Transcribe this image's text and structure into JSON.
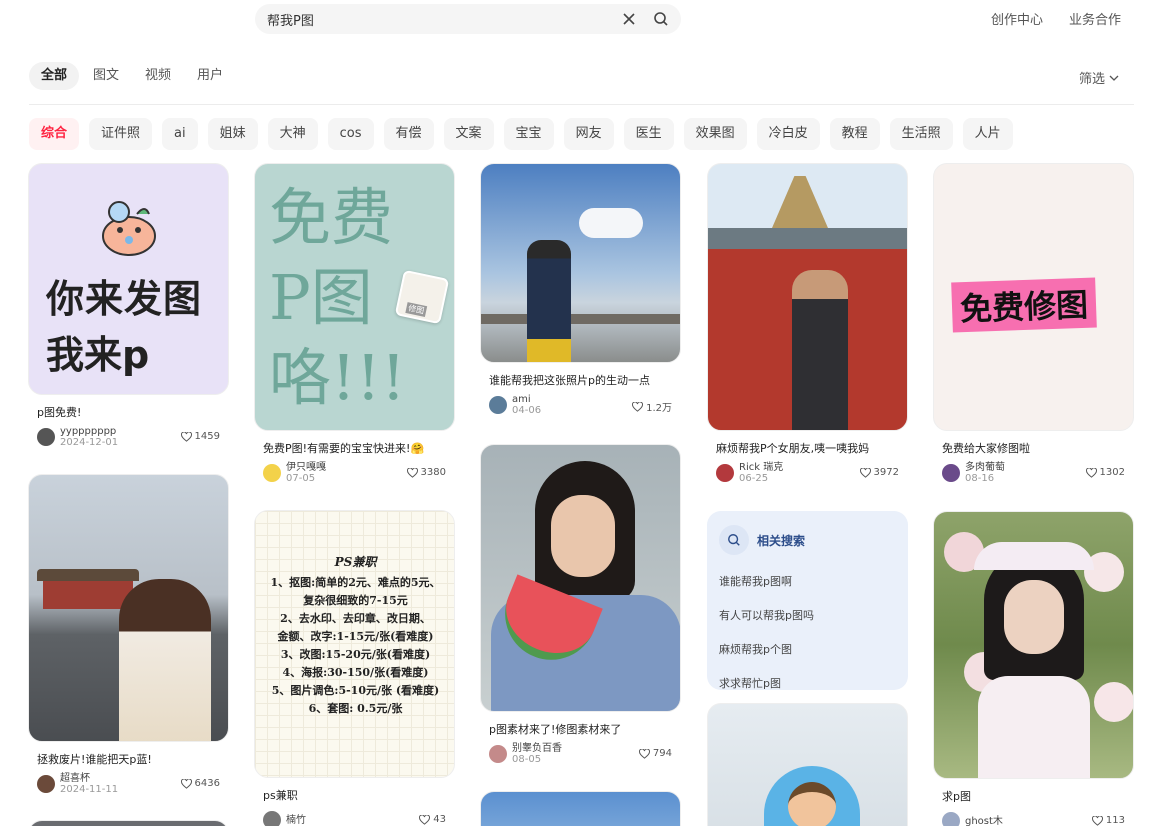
{
  "search": {
    "query": "帮我P图"
  },
  "top_links": [
    "创作中心",
    "业务合作"
  ],
  "tabs": [
    "全部",
    "图文",
    "视频",
    "用户"
  ],
  "filter_label": "筛选",
  "chips": [
    "综合",
    "证件照",
    "ai",
    "姐妹",
    "大神",
    "cos",
    "有偿",
    "文案",
    "宝宝",
    "网友",
    "医生",
    "效果图",
    "冷白皮",
    "教程",
    "生活照",
    "人片"
  ],
  "covers": {
    "c1_line1": "你来发图",
    "c1_line2": "我来p",
    "c2_text": "免费P图咯!!!",
    "c2_label": "修图",
    "c5_text": "免费修图",
    "c8_title": "PS兼职",
    "c8_lines": [
      "1、抠图:简单的2元、难点的5元、",
      "复杂很细致的7-15元",
      "2、去水印、去印章、改日期、",
      "金额、改字:1-15元/张(看难度)",
      "3、改图:15-20元/张(看难度)",
      "4、海报:30-150/张(看难度)",
      "5、图片调色:5-10元/张 (看难度)",
      "6、套图: 0.5元/张"
    ]
  },
  "cards": [
    {
      "title": "p图免费!",
      "author": "yyppppppp",
      "date": "2024-12-01",
      "likes": "1459"
    },
    {
      "title": "免费P图!有需要的宝宝快进来!🤗",
      "author": "伊只嘎嘎",
      "date": "07-05",
      "likes": "3380"
    },
    {
      "title": "谁能帮我把这张照片p的生动一点",
      "author": "ami",
      "date": "04-06",
      "likes": "1.2万"
    },
    {
      "title": "麻烦帮我P个女朋友,咦一咦我妈",
      "author": "Rick 瑞克",
      "date": "06-25",
      "likes": "3972"
    },
    {
      "title": "免费给大家修图啦",
      "author": "多肉葡萄",
      "date": "08-16",
      "likes": "1302"
    },
    {
      "title": "拯救废片!谁能把天p蓝!",
      "author": "超喜杯",
      "date": "2024-11-11",
      "likes": "6436"
    },
    {
      "title": "p图素材来了!修图素材来了",
      "author": "别睾负百香",
      "date": "08-05",
      "likes": "794"
    },
    {
      "title": "ps兼职",
      "author": "楠竹",
      "date": "",
      "likes": "43"
    },
    {
      "title": "求p图",
      "author": "ghost木",
      "date": "",
      "likes": "113"
    }
  ],
  "related": {
    "title": "相关搜索",
    "items": [
      "谁能帮我p图啊",
      "有人可以帮我p图吗",
      "麻烦帮我p个图",
      "求求帮忙p图"
    ]
  },
  "colors": {
    "accent": "#ff2442",
    "related_bg": "#eaf0fa"
  }
}
